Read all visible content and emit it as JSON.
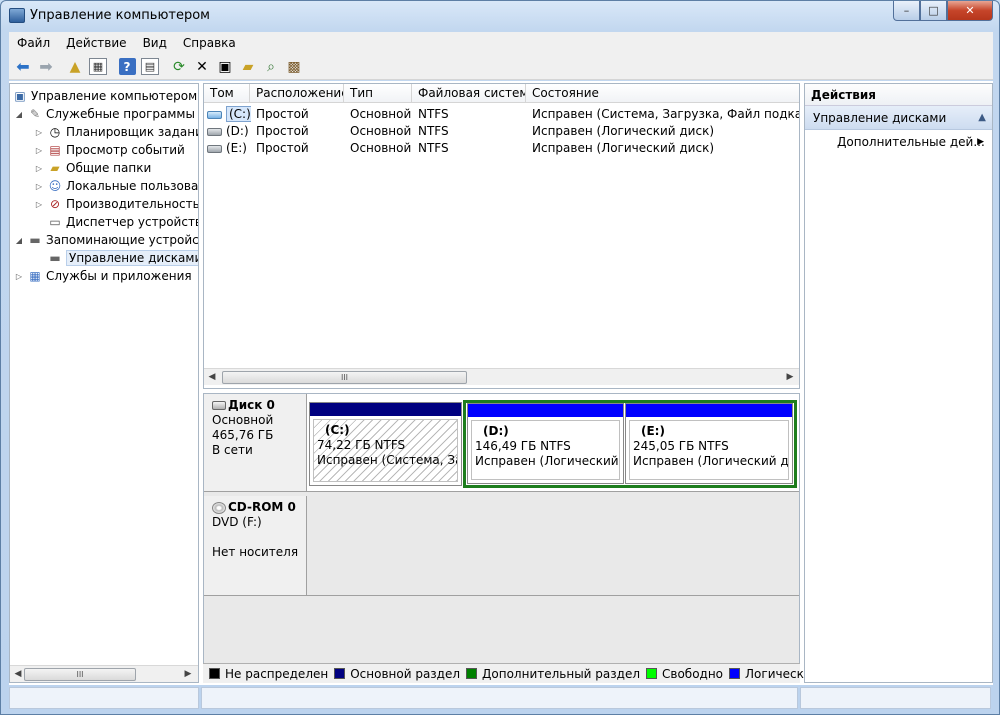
{
  "window": {
    "title": "Управление компьютером",
    "min_glyph": "–",
    "max_glyph": "□",
    "close_glyph": "✕"
  },
  "menu": [
    "Файл",
    "Действие",
    "Вид",
    "Справка"
  ],
  "tree": {
    "root": "Управление компьютером (л",
    "items": [
      {
        "label": "Служебные программы"
      },
      {
        "label": "Планировщик заданий"
      },
      {
        "label": "Просмотр событий"
      },
      {
        "label": "Общие папки"
      },
      {
        "label": "Локальные пользовате"
      },
      {
        "label": "Производительность"
      },
      {
        "label": "Диспетчер устройств"
      },
      {
        "label": "Запоминающие устройст"
      },
      {
        "label": "Управление дисками"
      },
      {
        "label": "Службы и приложения"
      }
    ],
    "scroll_thumb": "III"
  },
  "volumes": {
    "columns": [
      "Том",
      "Расположение",
      "Тип",
      "Файловая система",
      "Состояние"
    ],
    "rows": [
      {
        "vol": "(C:)",
        "layout": "Простой",
        "type": "Основной",
        "fs": "NTFS",
        "status": "Исправен (Система, Загрузка, Файл подкачки, А"
      },
      {
        "vol": "(D:)",
        "layout": "Простой",
        "type": "Основной",
        "fs": "NTFS",
        "status": "Исправен (Логический диск)"
      },
      {
        "vol": "(E:)",
        "layout": "Простой",
        "type": "Основной",
        "fs": "NTFS",
        "status": "Исправен (Логический диск)"
      }
    ],
    "scroll_thumb": "III"
  },
  "disks": [
    {
      "name": "Диск 0",
      "lines": [
        "Основной",
        "465,76 ГБ",
        "В сети"
      ],
      "partitions": [
        {
          "name": "(C:)",
          "size": "74,22 ГБ NTFS",
          "status": "Исправен (Система, Загр",
          "bar_color": "#000080"
        },
        {
          "name": "(D:)",
          "size": "146,49 ГБ NTFS",
          "status": "Исправен (Логический ди",
          "bar_color": "#0000ff"
        },
        {
          "name": "(E:)",
          "size": "245,05 ГБ NTFS",
          "status": "Исправен (Логический дис",
          "bar_color": "#0000ff"
        }
      ]
    },
    {
      "name": "CD-ROM 0",
      "lines": [
        "DVD (F:)",
        "",
        "Нет носителя"
      ]
    }
  ],
  "legend": [
    {
      "label": "Не распределен",
      "color": "#000000"
    },
    {
      "label": "Основной раздел",
      "color": "#000080"
    },
    {
      "label": "Дополнительный раздел",
      "color": "#008000"
    },
    {
      "label": "Свободно",
      "color": "#00ff00"
    },
    {
      "label": "Логический диск",
      "color": "#0000ff"
    }
  ],
  "actions": {
    "header": "Действия",
    "section": "Управление дисками",
    "item": "Дополнительные дей..."
  },
  "colors": {
    "extended_border": "#1d7d1d"
  }
}
